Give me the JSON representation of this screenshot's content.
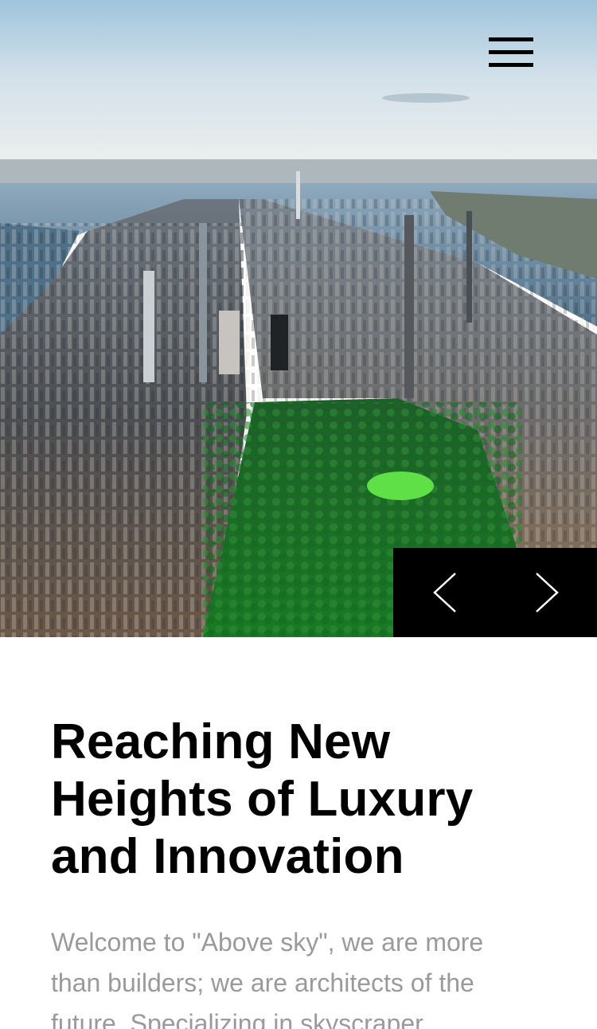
{
  "hero": {
    "image_icon": "city-skyline-aerial-photo",
    "menu_icon": "hamburger-menu-icon",
    "prev_icon": "chevron-left-icon",
    "next_icon": "chevron-right-icon"
  },
  "content": {
    "headline": "Reaching New Heights of Luxury and Innovation",
    "intro": "Welcome to \"Above sky\", we are more than builders; we are architects of the future. Specializing in skyscraper"
  },
  "colors": {
    "text_primary": "#000000",
    "text_secondary": "#9a9a9a",
    "controls_bg": "#000000",
    "controls_fg": "#ffffff"
  }
}
